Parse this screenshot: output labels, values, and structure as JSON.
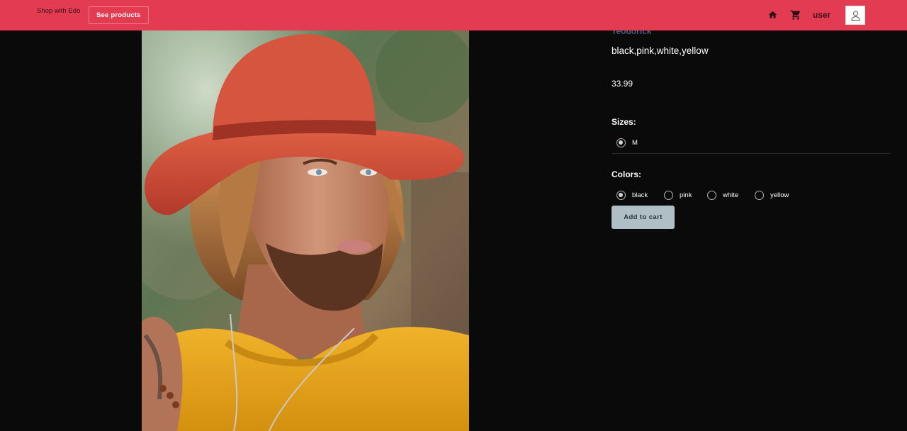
{
  "header": {
    "brand": "Shop with Edo",
    "see_products_label": "See products",
    "user_label": "user",
    "icons": [
      "home-icon",
      "cart-icon",
      "user-icon"
    ],
    "bar_color": "#e23b52"
  },
  "product": {
    "brand": "Teodorick",
    "colors_text": "black,pink,white,yellow",
    "price": "33.99",
    "sizes_title": "Sizes:",
    "sizes": [
      {
        "label": "M",
        "selected": true
      }
    ],
    "colors_title": "Colors:",
    "colors": [
      {
        "label": "black",
        "selected": true
      },
      {
        "label": "pink",
        "selected": false
      },
      {
        "label": "white",
        "selected": false
      },
      {
        "label": "yellow",
        "selected": false
      }
    ],
    "add_to_cart_label": "Add to cart"
  },
  "theme": {
    "background": "#0a0a0a",
    "accent": "#e23b52",
    "button": "#b0bec5"
  }
}
